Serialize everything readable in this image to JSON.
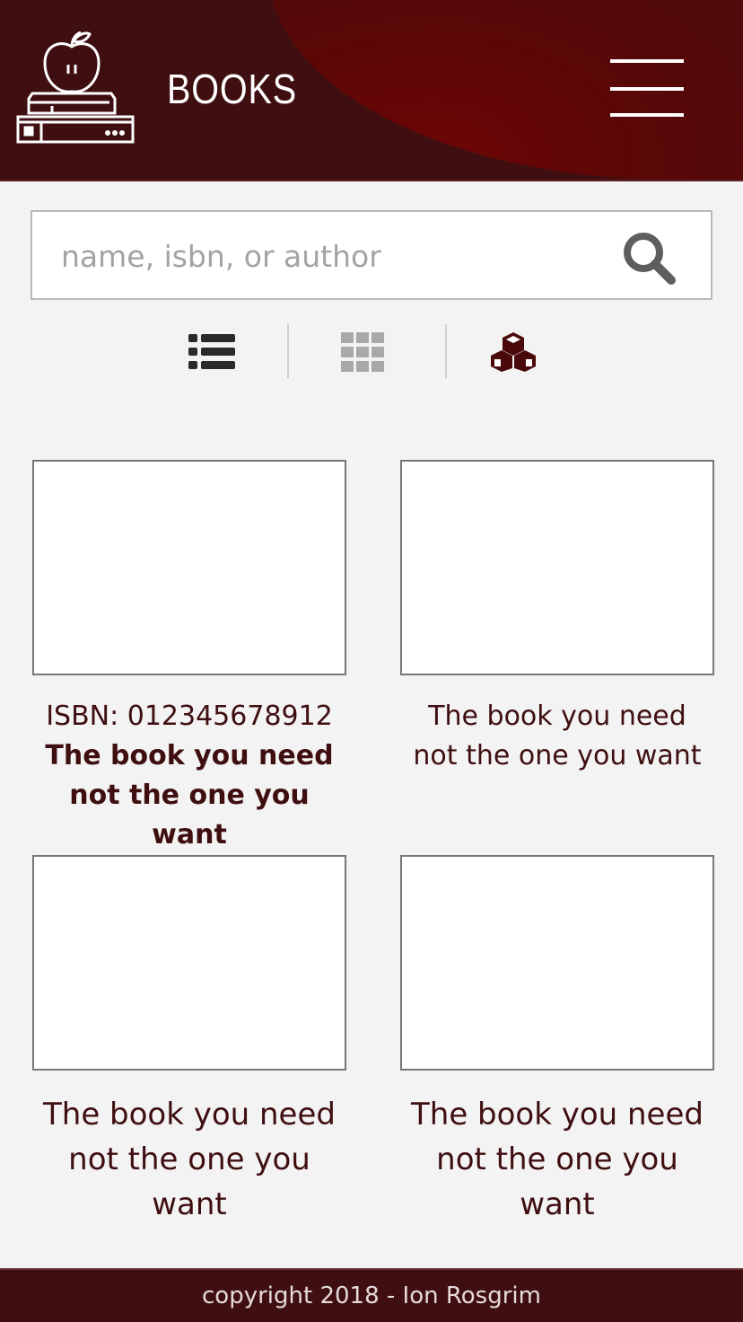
{
  "header": {
    "title": "BOOKS",
    "logo_icon": "apple-on-books-icon",
    "menu_icon": "hamburger-menu-icon",
    "background_color": "#3f0e10",
    "accent_color": "#6e0505"
  },
  "search": {
    "placeholder": "name, isbn, or author",
    "value": "",
    "icon": "search-icon"
  },
  "view_toggle": {
    "options": [
      {
        "name": "list-view",
        "icon": "list-icon",
        "active": false
      },
      {
        "name": "grid-view",
        "icon": "grid-icon",
        "active": false
      },
      {
        "name": "cube-view",
        "icon": "cubes-icon",
        "active": true
      }
    ]
  },
  "books": [
    {
      "isbn_label": "ISBN: 012345678912",
      "title_line1": "The book you need",
      "title_line2": "not the one you want",
      "selected": true
    },
    {
      "title_line1": "The book you need",
      "title_line2": "not the one you want"
    },
    {
      "title_line1": "The book you need",
      "title_line2": "not the one you want"
    },
    {
      "title_line1": "The book you need",
      "title_line2": "not the one you want"
    }
  ],
  "footer": {
    "text": "copyright 2018 - Ion Rosgrim"
  },
  "colors": {
    "text_primary": "#3f0e10",
    "page_background": "#f3f3f3"
  }
}
